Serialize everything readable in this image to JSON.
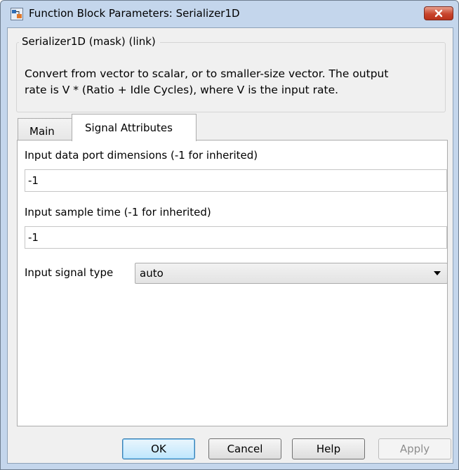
{
  "window": {
    "title": "Function Block Parameters: Serializer1D"
  },
  "description": {
    "group_title": "Serializer1D (mask) (link)",
    "line1": "Convert from vector to scalar, or to smaller-size vector. The output",
    "line2": "rate is V * (Ratio + Idle Cycles), where V is the input rate."
  },
  "tabs": [
    {
      "label": "Main",
      "active": false
    },
    {
      "label": "Signal Attributes",
      "active": true
    }
  ],
  "fields": {
    "input_dims_label": "Input data port dimensions (-1 for inherited)",
    "input_dims_value": "-1",
    "sample_time_label": "Input sample time (-1 for inherited)",
    "sample_time_value": "-1",
    "signal_type_label": "Input signal type",
    "signal_type_value": "auto"
  },
  "buttons": {
    "ok": "OK",
    "cancel": "Cancel",
    "help": "Help",
    "apply": "Apply"
  },
  "icons": {
    "app": "simulink-block-icon",
    "close": "close-icon",
    "dropdown": "chevron-down-icon"
  },
  "colors": {
    "close_button": "#c8452d",
    "window_frame": "#c4d6ec",
    "ok_button_accent": "#3c7fb1"
  }
}
